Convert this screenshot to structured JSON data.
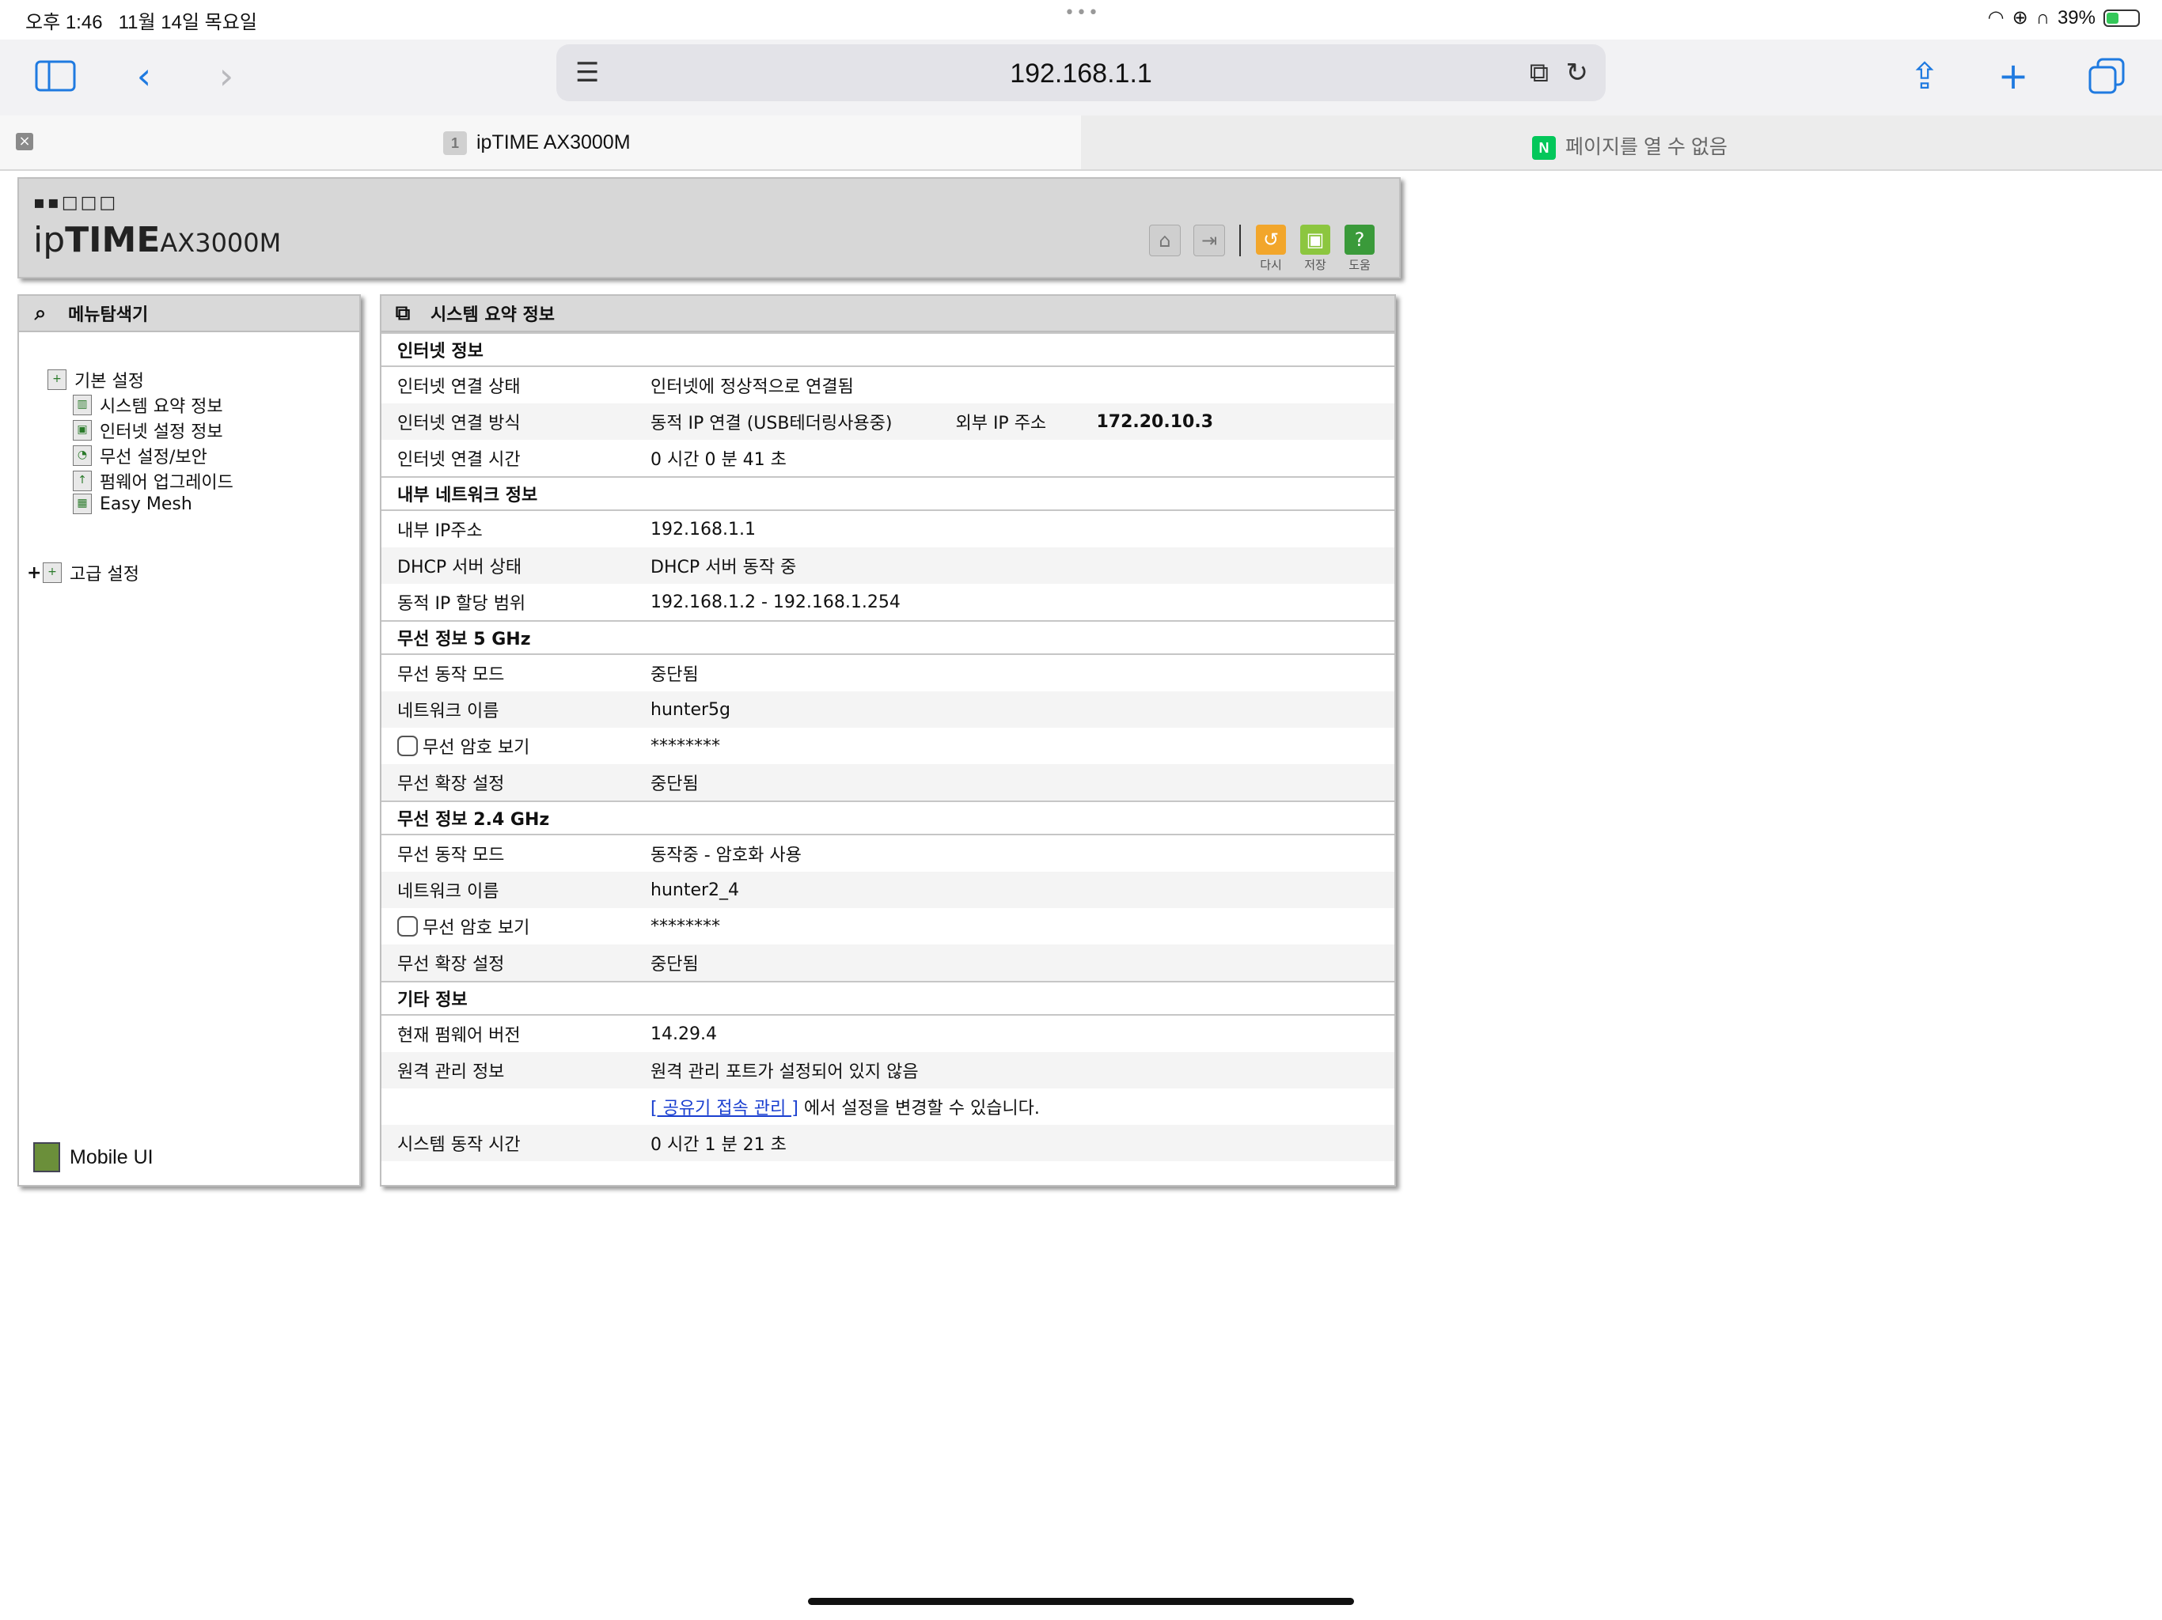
{
  "status": {
    "time": "오후 1:46",
    "date": "11월 14일 목요일",
    "battery": "39%",
    "battery_level": 0.39
  },
  "toolbar": {
    "address": "192.168.1.1"
  },
  "tabs": [
    {
      "favicon": "1",
      "title": "ipTIME AX3000M"
    },
    {
      "favicon": "N",
      "title": "페이지를 열 수 없음"
    }
  ],
  "header": {
    "logo_dots": "▪▪□□□",
    "brand_a": "ip",
    "brand_b": "TIME",
    "model": "AX3000M",
    "buttons": [
      {
        "label": "다시",
        "color": "#f2a62b"
      },
      {
        "label": "저장",
        "color": "#8cc63f"
      },
      {
        "label": "도움",
        "color": "#3a9a3a"
      }
    ]
  },
  "sidebar": {
    "title": "메뉴탐색기",
    "groups": [
      {
        "label": "기본 설정",
        "items": [
          "시스템 요약 정보",
          "인터넷 설정 정보",
          "무선 설정/보안",
          "펌웨어 업그레이드",
          "Easy Mesh"
        ]
      },
      {
        "label": "고급 설정",
        "expander": "+"
      }
    ],
    "footer": "Mobile UI"
  },
  "main": {
    "title": "시스템 요약 정보",
    "sections": [
      {
        "title": "인터넷 정보",
        "rows": [
          {
            "label": "인터넷 연결 상태",
            "value": "인터넷에 정상적으로 연결됨"
          },
          {
            "label": "인터넷 연결 방식",
            "value": "동적 IP 연결 (USB테더링사용중)",
            "extra_label": "외부 IP 주소",
            "extra_value": "172.20.10.3"
          },
          {
            "label": "인터넷 연결 시간",
            "value": "0 시간 0 분 41 초"
          }
        ]
      },
      {
        "title": "내부 네트워크 정보",
        "rows": [
          {
            "label": "내부 IP주소",
            "value": "192.168.1.1"
          },
          {
            "label": "DHCP 서버 상태",
            "value": "DHCP 서버 동작 중"
          },
          {
            "label": "동적 IP 할당 범위",
            "value": "192.168.1.2 -  192.168.1.254"
          }
        ]
      },
      {
        "title": "무선 정보 5 GHz",
        "rows": [
          {
            "label": "무선 동작 모드",
            "value": "중단됨"
          },
          {
            "label": "네트워크 이름",
            "value": "hunter5g"
          },
          {
            "label": "무선 암호 보기",
            "value": "********",
            "checkbox": true
          },
          {
            "label": "무선 확장 설정",
            "value": "중단됨"
          }
        ]
      },
      {
        "title": "무선 정보 2.4 GHz",
        "rows": [
          {
            "label": "무선 동작 모드",
            "value": "동작중 - 암호화 사용"
          },
          {
            "label": "네트워크 이름",
            "value": "hunter2_4"
          },
          {
            "label": "무선 암호 보기",
            "value": "********",
            "checkbox": true
          },
          {
            "label": "무선 확장 설정",
            "value": "중단됨"
          }
        ]
      },
      {
        "title": "기타 정보",
        "rows": [
          {
            "label": "현재 펌웨어 버전",
            "value": "14.29.4"
          },
          {
            "label": "원격 관리 정보",
            "value": "원격 관리 포트가 설정되어 있지 않음"
          },
          {
            "label": "",
            "link": "[ 공유기 접속 관리 ]",
            "value": " 에서 설정을 변경할 수 있습니다."
          },
          {
            "label": "시스템 동작 시간",
            "value": "0 시간 1 분 21 초"
          }
        ]
      }
    ]
  }
}
